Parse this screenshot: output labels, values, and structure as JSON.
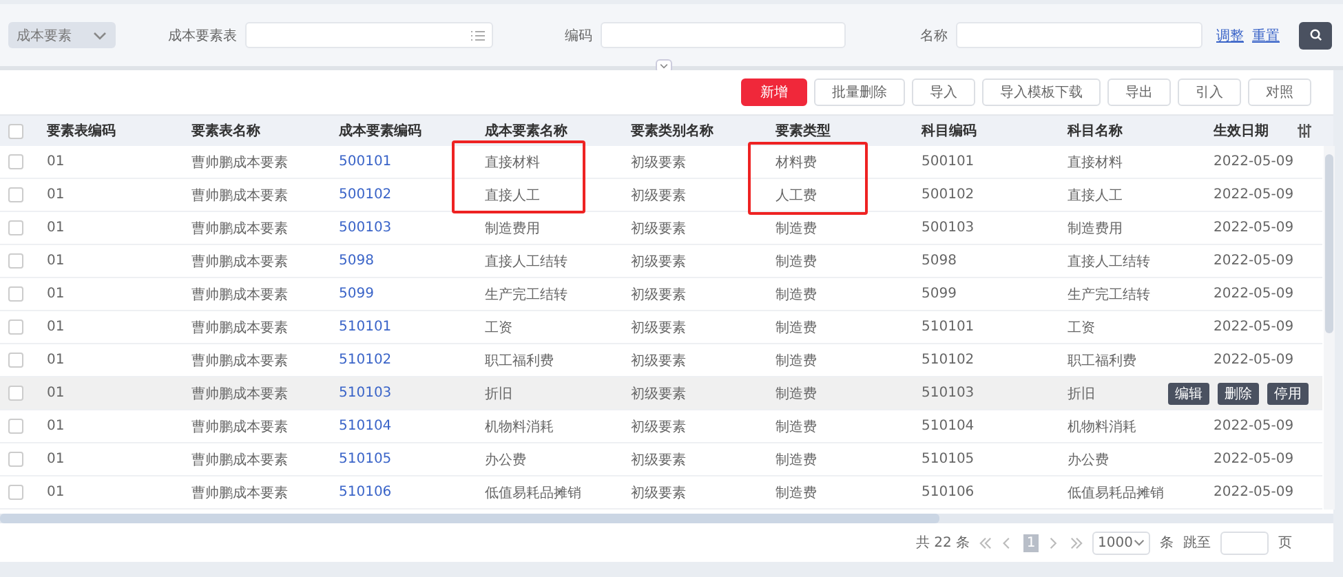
{
  "filter": {
    "category": {
      "value": "成本要素"
    },
    "fields": [
      {
        "label": "成本要素表",
        "kind": "list"
      },
      {
        "label": "编码",
        "kind": "text"
      },
      {
        "label": "名称",
        "kind": "text"
      }
    ],
    "links": [
      "调整",
      "重置"
    ]
  },
  "toolbar": [
    {
      "label": "新增",
      "kind": "primary"
    },
    {
      "label": "批量删除",
      "kind": "default"
    },
    {
      "label": "导入",
      "kind": "default"
    },
    {
      "label": "导入模板下载",
      "kind": "default"
    },
    {
      "label": "导出",
      "kind": "default"
    },
    {
      "label": "引入",
      "kind": "default"
    },
    {
      "label": "对照",
      "kind": "default"
    }
  ],
  "table": {
    "select_all": {
      "checked": false
    },
    "columns": [
      {
        "label": "要素表编码",
        "kind": "text"
      },
      {
        "label": "要素表名称",
        "kind": "text"
      },
      {
        "label": "成本要素编码",
        "kind": "link"
      },
      {
        "label": "成本要素名称",
        "kind": "text"
      },
      {
        "label": "要素类别名称",
        "kind": "text"
      },
      {
        "label": "要素类型",
        "kind": "text"
      },
      {
        "label": "科目编码",
        "kind": "text"
      },
      {
        "label": "科目名称",
        "kind": "text"
      },
      {
        "label": "生效日期",
        "kind": "text"
      }
    ],
    "rows": [
      {
        "checked": false,
        "hovered": false,
        "cells": [
          "01",
          "曹帅鹏成本要素",
          "500101",
          "直接材料",
          "初级要素",
          "材料费",
          "500101",
          "直接材料",
          "2022-05-09"
        ]
      },
      {
        "checked": false,
        "hovered": false,
        "cells": [
          "01",
          "曹帅鹏成本要素",
          "500102",
          "直接人工",
          "初级要素",
          "人工费",
          "500102",
          "直接人工",
          "2022-05-09"
        ]
      },
      {
        "checked": false,
        "hovered": false,
        "cells": [
          "01",
          "曹帅鹏成本要素",
          "500103",
          "制造费用",
          "初级要素",
          "制造费",
          "500103",
          "制造费用",
          "2022-05-09"
        ]
      },
      {
        "checked": false,
        "hovered": false,
        "cells": [
          "01",
          "曹帅鹏成本要素",
          "5098",
          "直接人工结转",
          "初级要素",
          "制造费",
          "5098",
          "直接人工结转",
          "2022-05-09"
        ]
      },
      {
        "checked": false,
        "hovered": false,
        "cells": [
          "01",
          "曹帅鹏成本要素",
          "5099",
          "生产完工结转",
          "初级要素",
          "制造费",
          "5099",
          "生产完工结转",
          "2022-05-09"
        ]
      },
      {
        "checked": false,
        "hovered": false,
        "cells": [
          "01",
          "曹帅鹏成本要素",
          "510101",
          "工资",
          "初级要素",
          "制造费",
          "510101",
          "工资",
          "2022-05-09"
        ]
      },
      {
        "checked": false,
        "hovered": false,
        "cells": [
          "01",
          "曹帅鹏成本要素",
          "510102",
          "职工福利费",
          "初级要素",
          "制造费",
          "510102",
          "职工福利费",
          "2022-05-09"
        ]
      },
      {
        "checked": false,
        "hovered": true,
        "cells": [
          "01",
          "曹帅鹏成本要素",
          "510103",
          "折旧",
          "初级要素",
          "制造费",
          "510103",
          "折旧"
        ],
        "actions": [
          "编辑",
          "删除",
          "停用"
        ]
      },
      {
        "checked": false,
        "hovered": false,
        "cells": [
          "01",
          "曹帅鹏成本要素",
          "510104",
          "机物料消耗",
          "初级要素",
          "制造费",
          "510104",
          "机物料消耗",
          "2022-05-09"
        ]
      },
      {
        "checked": false,
        "hovered": false,
        "cells": [
          "01",
          "曹帅鹏成本要素",
          "510105",
          "办公费",
          "初级要素",
          "制造费",
          "510105",
          "办公费",
          "2022-05-09"
        ]
      },
      {
        "checked": false,
        "hovered": false,
        "cells": [
          "01",
          "曹帅鹏成本要素",
          "510106",
          "低值易耗品摊销",
          "初级要素",
          "制造费",
          "510106",
          "低值易耗品摊销",
          "2022-05-09"
        ]
      }
    ]
  },
  "pagination": {
    "total": "共 22 条",
    "pages": [
      {
        "label": "1",
        "selected": true
      }
    ],
    "page_size": "1000",
    "unit": "条",
    "jump_label": "跳至",
    "page_unit": "页"
  }
}
